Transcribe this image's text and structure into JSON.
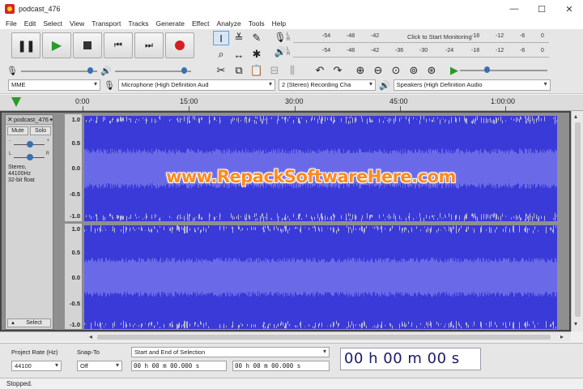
{
  "window": {
    "title": "podcast_476",
    "controls": [
      "—",
      "☐",
      "✕"
    ]
  },
  "menu": [
    "File",
    "Edit",
    "Select",
    "View",
    "Transport",
    "Tracks",
    "Generate",
    "Effect",
    "Analyze",
    "Tools",
    "Help"
  ],
  "meters": {
    "record_scale": [
      "-54",
      "-48",
      "-42",
      "-18",
      "-12",
      "-6",
      "0"
    ],
    "monitor_message": "Click to Start Monitoring",
    "play_scale": [
      "-54",
      "-48",
      "-42",
      "-36",
      "-30",
      "-24",
      "-18",
      "-12",
      "-6",
      "0"
    ],
    "lr_label": "L\nR"
  },
  "devices": {
    "host": "MME",
    "recording_device": "Microphone (High Definition Aud",
    "recording_channels": "2 (Stereo) Recording Cha",
    "playback_device": "Speakers (High Definition Audio"
  },
  "timeline": {
    "labels": [
      "0:00",
      "15:00",
      "30:00",
      "45:00",
      "1:00:00"
    ]
  },
  "track": {
    "name": "podcast_476",
    "mute_label": "Mute",
    "solo_label": "Solo",
    "gain_left": "-",
    "gain_right": "+",
    "pan_left": "L",
    "pan_right": "R",
    "info_line1": "Stereo, 44100Hz",
    "info_line2": "32-bit float",
    "select_label": "Select",
    "ruler_labels": [
      "1.0",
      "0.5",
      "0.0",
      "-0.5",
      "-1.0"
    ]
  },
  "selection": {
    "project_rate_label": "Project Rate (Hz)",
    "project_rate_value": "44100",
    "snap_to_label": "Snap-To",
    "snap_to_value": "Off",
    "selection_mode": "Start and End of Selection",
    "start_time": "00 h 00 m 00.000 s",
    "end_time": "00 h 00 m 00.000 s",
    "audio_position": "00 h 00 m 00 s"
  },
  "status": {
    "text": "Stopped."
  },
  "watermark": "www.RepackSoftwareHere.com",
  "colors": {
    "waveform": "#3a3ad8",
    "waveform_rms": "#6a6ae8",
    "waveform_peaks": "#b8b8cc",
    "play_green": "#2a9a2a",
    "record_red": "#d42020"
  }
}
